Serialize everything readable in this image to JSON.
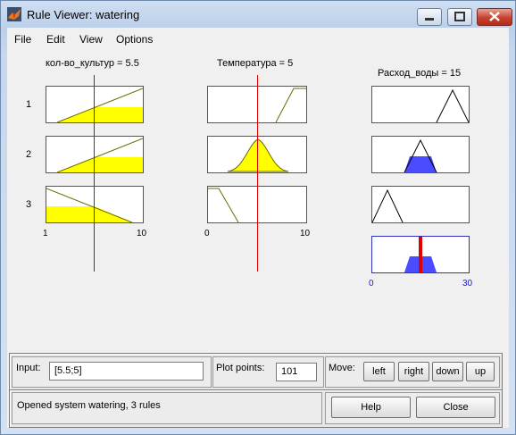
{
  "window": {
    "title": "Rule Viewer: watering"
  },
  "menu": [
    "File",
    "Edit",
    "View",
    "Options"
  ],
  "inputs": [
    {
      "name": "кол-во_культур",
      "value_label": "кол-во_культур = 5.5",
      "range": [
        1,
        10
      ],
      "tick_min": "1",
      "tick_max": "10",
      "value": 5.5
    },
    {
      "name": "Температура",
      "value_label": "Температура = 5",
      "range": [
        0,
        10
      ],
      "tick_min": "0",
      "tick_max": "10",
      "value": 5
    }
  ],
  "output": {
    "name": "Расход_воды",
    "value_label": "Расход_воды = 15",
    "range": [
      0,
      30
    ],
    "tick_min": "0",
    "tick_max": "30",
    "value": 15
  },
  "rules": [
    {
      "label": "1"
    },
    {
      "label": "2"
    },
    {
      "label": "3"
    }
  ],
  "colors": {
    "input_fill": "#ffff00",
    "output_fill": "#4b4bff",
    "indicator": "#e00000",
    "mf_line": "#6b6b00"
  },
  "controls": {
    "input_label": "Input:",
    "input_value": "[5.5;5]",
    "plot_points_label": "Plot points:",
    "plot_points_value": "101",
    "move_label": "Move:",
    "left": "left",
    "right": "right",
    "down": "down",
    "up": "up",
    "help": "Help",
    "close": "Close"
  },
  "status": "Opened system watering, 3 rules"
}
